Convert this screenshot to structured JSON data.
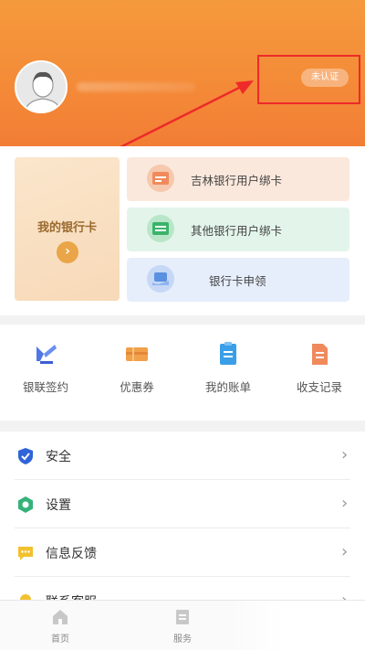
{
  "header": {
    "verify_status": "未认证"
  },
  "cards": {
    "my_card_label": "我的银行卡",
    "options": [
      {
        "label": "吉林银行用户绑卡",
        "icon": "card-bind-icon"
      },
      {
        "label": "其他银行用户绑卡",
        "icon": "card-stack-icon"
      },
      {
        "label": "银行卡申领",
        "icon": "card-apply-icon"
      }
    ]
  },
  "quick": [
    {
      "label": "银联签约",
      "icon": "unionpay-sign-icon"
    },
    {
      "label": "优惠券",
      "icon": "coupon-icon"
    },
    {
      "label": "我的账单",
      "icon": "bill-icon"
    },
    {
      "label": "收支记录",
      "icon": "record-icon"
    }
  ],
  "list": [
    {
      "label": "安全",
      "icon": "shield-icon"
    },
    {
      "label": "设置",
      "icon": "settings-icon"
    },
    {
      "label": "信息反馈",
      "icon": "feedback-icon"
    },
    {
      "label": "联系客服",
      "icon": "customer-service-icon"
    }
  ],
  "tabbar": [
    {
      "label": "首页",
      "icon": "home-icon"
    },
    {
      "label": "服务",
      "icon": "service-icon"
    }
  ],
  "colors": {
    "header": "#f48a38",
    "highlight": "#ee2a2a"
  }
}
